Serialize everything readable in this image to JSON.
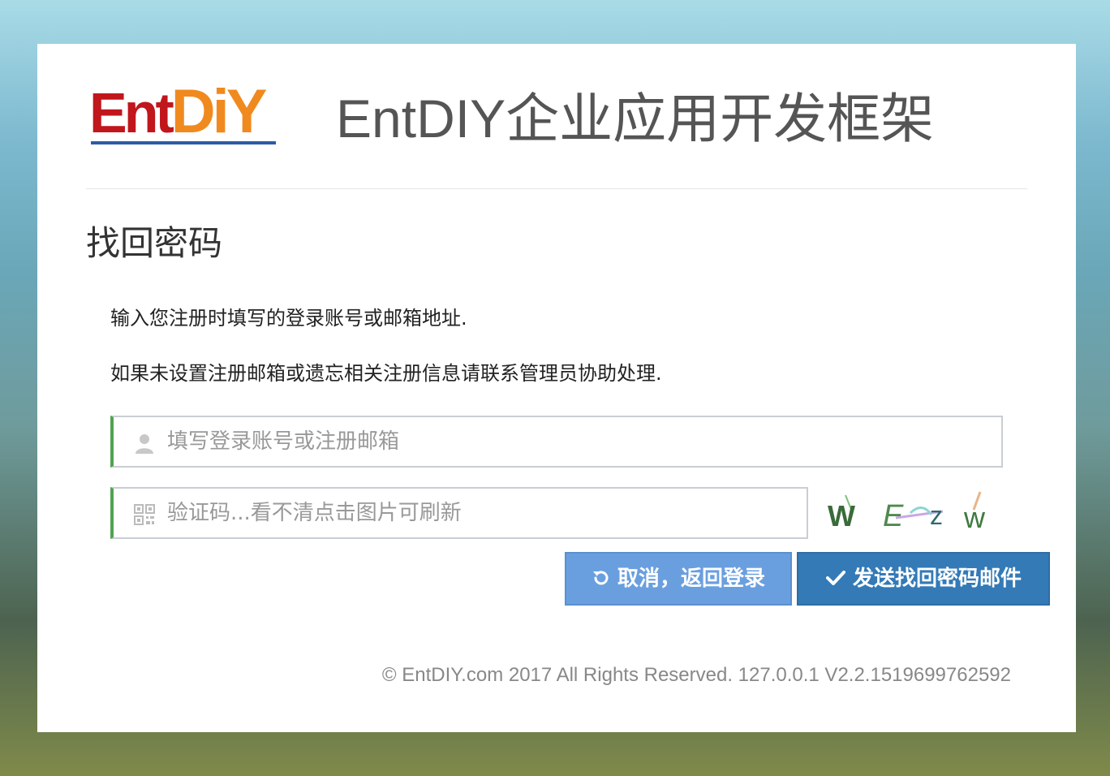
{
  "brand": {
    "logo_part1": "Ent",
    "logo_part2": "DiY",
    "title": "EntDIY企业应用开发框架"
  },
  "page": {
    "heading": "找回密码",
    "instructions": [
      "输入您注册时填写的登录账号或邮箱地址.",
      "如果未设置注册邮箱或遗忘相关注册信息请联系管理员协助处理."
    ]
  },
  "form": {
    "account": {
      "placeholder": "填写登录账号或注册邮箱",
      "icon": "user-icon"
    },
    "captcha": {
      "placeholder": "验证码...看不清点击图片可刷新",
      "icon": "qrcode-icon",
      "image_text": "WEZW"
    }
  },
  "buttons": {
    "cancel": {
      "label": "取消，返回登录",
      "icon": "undo-icon"
    },
    "send": {
      "label": "发送找回密码邮件",
      "icon": "check-icon"
    }
  },
  "footer": {
    "text": "© EntDIY.com 2017 All Rights Reserved. 127.0.0.1 V2.2.1519699762592"
  },
  "colors": {
    "field_accent": "#51a351",
    "cancel_button": "#6a9fdf",
    "send_button": "#337ab7",
    "logo_red": "#c1161c",
    "logo_orange": "#f08a1e"
  }
}
